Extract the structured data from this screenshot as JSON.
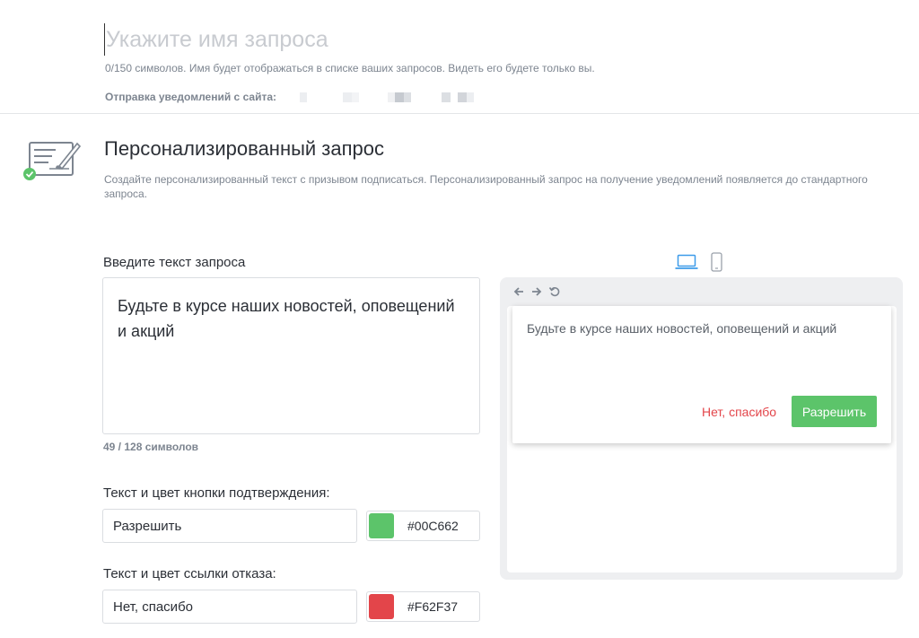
{
  "request_name": {
    "placeholder": "Укажите имя запроса",
    "hint": "0/150 символов. Имя будет отображаться в списке ваших запросов. Видеть его будете только вы.",
    "site_label": "Отправка уведомлений с сайта:"
  },
  "section": {
    "title": "Персонализированный запрос",
    "description": "Создайте персонализированный текст с призывом подписаться. Персонализированный запрос на получение уведомлений появляется до стандартного запроса."
  },
  "form": {
    "text_label": "Введите текст запроса",
    "text_value": "Будьте в курсе наших новостей, оповещений и акций",
    "counter": "49 / 128 символов",
    "confirm_label": "Текст и цвет кнопки подтверждения:",
    "confirm_text": "Разрешить",
    "confirm_color": "#00C662",
    "deny_label": "Текст и цвет ссылки отказа:",
    "deny_text": "Нет, спасибо",
    "deny_color": "#F62F37"
  },
  "devices": {
    "active": "desktop",
    "accent": "#3d9be9"
  },
  "preview": {
    "text": "Будьте в курсе наших новостей, оповещений и акций",
    "deny": "Нет, спасибо",
    "allow": "Разрешить",
    "allow_bg": "#5cc46a",
    "deny_fg": "#e3454a"
  },
  "icons": {
    "back": "arrow-left-icon",
    "forward": "arrow-right-icon",
    "reload": "reload-icon",
    "section": "signed-form-check-icon",
    "desktop": "laptop-icon",
    "mobile": "phone-icon"
  }
}
